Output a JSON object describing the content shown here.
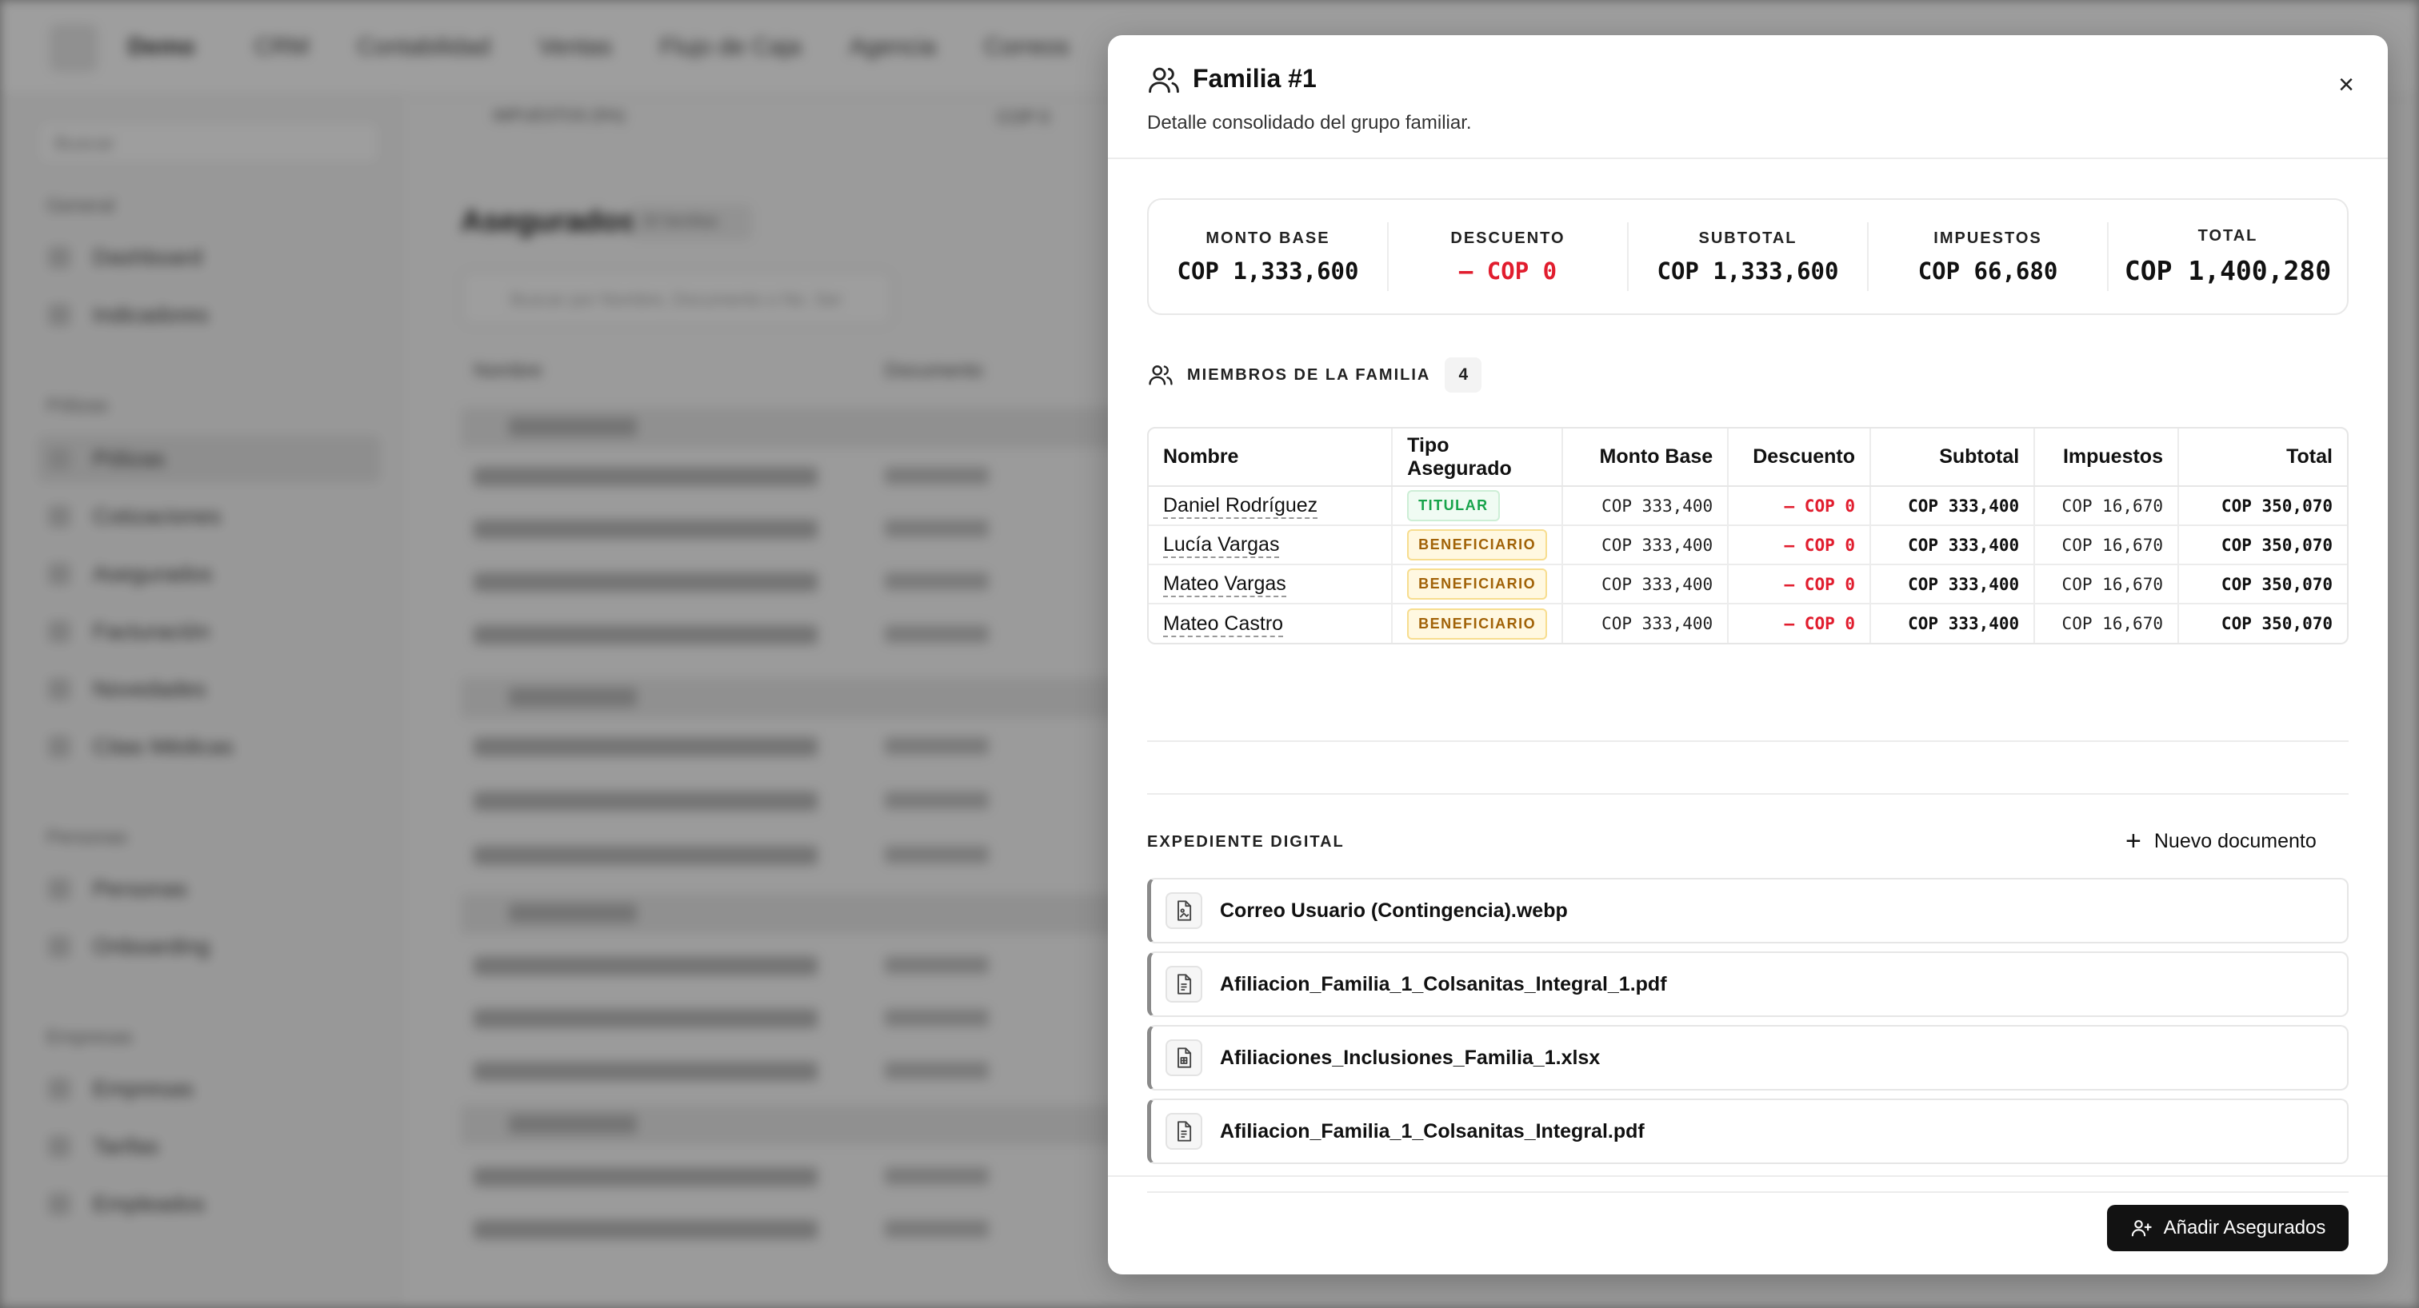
{
  "background": {
    "brand": "Demo",
    "nav": [
      "CRM",
      "Contabilidad",
      "Ventas",
      "Flujo de Caja",
      "Agencia",
      "Correos"
    ],
    "search_placeholder": "Buscar",
    "sidebar_sections": [
      {
        "title": "General",
        "items": [
          "Dashboard",
          "Indicadores"
        ]
      },
      {
        "title": "Pólizas",
        "items": [
          "Pólizas",
          "Cotizaciones",
          "Asegurados",
          "Facturación",
          "Novedades",
          "Citas Médicas"
        ]
      },
      {
        "title": "Personas",
        "items": [
          "Personas",
          "Onboarding"
        ]
      },
      {
        "title": "Empresas",
        "items": [
          "Empresas",
          "Tarifas",
          "Empleados"
        ]
      }
    ],
    "main_title": "Asegurados",
    "main_chip": "20 familias",
    "impuestos_label": "IMPUESTOS (5%)",
    "impuestos_value": "COP 0",
    "table_search_placeholder": "Buscar por Nombre, Documento o No. Ser",
    "col_nombre": "Nombre",
    "col_documento": "Documento"
  },
  "modal": {
    "title": "Familia #1",
    "subtitle": "Detalle consolidado del grupo familiar.",
    "close_glyph": "×",
    "summary": [
      {
        "label": "MONTO BASE",
        "value": "COP 1,333,600"
      },
      {
        "label": "DESCUENTO",
        "value": "– COP 0"
      },
      {
        "label": "SUBTOTAL",
        "value": "COP 1,333,600"
      },
      {
        "label": "IMPUESTOS",
        "value": "COP 66,680"
      },
      {
        "label": "TOTAL",
        "value": "COP 1,400,280"
      }
    ],
    "members_label": "MIEMBROS DE LA FAMILIA",
    "members_count": "4",
    "table": {
      "headers": [
        "Nombre",
        "Tipo Asegurado",
        "Monto Base",
        "Descuento",
        "Subtotal",
        "Impuestos",
        "Total"
      ],
      "rows": [
        {
          "name": "Daniel Rodríguez",
          "tipo": "TITULAR",
          "monto": "COP 333,400",
          "descuento": "– COP 0",
          "subtotal": "COP 333,400",
          "impuestos": "COP 16,670",
          "total": "COP 350,070"
        },
        {
          "name": "Lucía Vargas",
          "tipo": "BENEFICIARIO",
          "monto": "COP 333,400",
          "descuento": "– COP 0",
          "subtotal": "COP 333,400",
          "impuestos": "COP 16,670",
          "total": "COP 350,070"
        },
        {
          "name": "Mateo Vargas",
          "tipo": "BENEFICIARIO",
          "monto": "COP 333,400",
          "descuento": "– COP 0",
          "subtotal": "COP 333,400",
          "impuestos": "COP 16,670",
          "total": "COP 350,070"
        },
        {
          "name": "Mateo Castro",
          "tipo": "BENEFICIARIO",
          "monto": "COP 333,400",
          "descuento": "– COP 0",
          "subtotal": "COP 333,400",
          "impuestos": "COP 16,670",
          "total": "COP 350,070"
        }
      ]
    },
    "docs_label": "EXPEDIENTE DIGITAL",
    "new_doc_label": "Nuevo documento",
    "documents": [
      {
        "name": "Correo Usuario (Contingencia).webp",
        "icon": "image-file-icon"
      },
      {
        "name": "Afiliacion_Familia_1_Colsanitas_Integral_1.pdf",
        "icon": "pdf-file-icon"
      },
      {
        "name": "Afiliaciones_Inclusiones_Familia_1.xlsx",
        "icon": "spreadsheet-file-icon"
      },
      {
        "name": "Afiliacion_Familia_1_Colsanitas_Integral.pdf",
        "icon": "pdf-file-icon"
      }
    ],
    "footer_button": "Añadir Asegurados"
  },
  "colors": {
    "negative": "#e11d2e",
    "titular_badge": "#16a34a",
    "beneficiario_badge": "#a16207",
    "primary_button": "#121212"
  }
}
